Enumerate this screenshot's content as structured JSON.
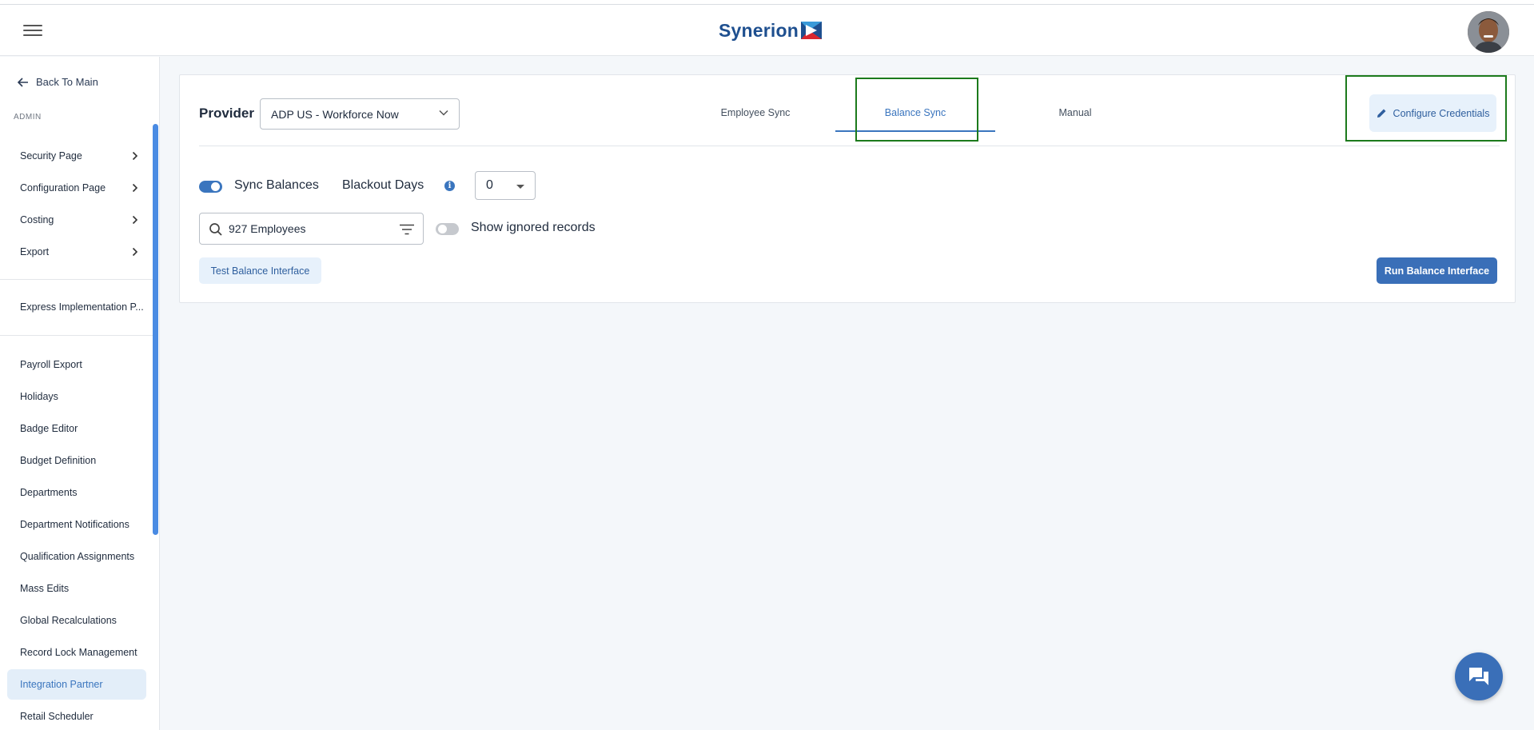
{
  "header": {
    "brand": "Synerion",
    "menu_icon": "hamburger-icon",
    "avatar": "user-avatar"
  },
  "sidebar": {
    "back_label": "Back To Main",
    "section_label": "ADMIN",
    "expandable": [
      {
        "label": "Security Page"
      },
      {
        "label": "Configuration Page"
      },
      {
        "label": "Costing"
      },
      {
        "label": "Export"
      }
    ],
    "express": "Express Implementation P...",
    "items": [
      {
        "label": "Payroll Export"
      },
      {
        "label": "Holidays"
      },
      {
        "label": "Badge Editor"
      },
      {
        "label": "Budget Definition"
      },
      {
        "label": "Departments"
      },
      {
        "label": "Department Notifications"
      },
      {
        "label": "Qualification Assignments"
      },
      {
        "label": "Mass Edits"
      },
      {
        "label": "Global Recalculations"
      },
      {
        "label": "Record Lock Management"
      },
      {
        "label": "Integration Partner",
        "active": true
      },
      {
        "label": "Retail Scheduler"
      }
    ]
  },
  "main": {
    "provider_label": "Provider",
    "provider_value": "ADP US - Workforce Now",
    "tabs": [
      {
        "label": "Employee Sync"
      },
      {
        "label": "Balance Sync",
        "active": true
      },
      {
        "label": "Manual"
      }
    ],
    "configure_label": "Configure Credentials",
    "sync_balances_label": "Sync Balances",
    "sync_balances_on": true,
    "blackout_label": "Blackout Days",
    "blackout_value": "0",
    "search_value": "927 Employees",
    "show_ignored_label": "Show ignored records",
    "show_ignored_on": false,
    "test_button": "Test Balance Interface",
    "run_button": "Run Balance Interface"
  },
  "colors": {
    "accent": "#3a75be",
    "brand": "#1e4f8f",
    "highlight_box": "#1c7a1c",
    "active_nav_bg": "#e3eef9"
  }
}
